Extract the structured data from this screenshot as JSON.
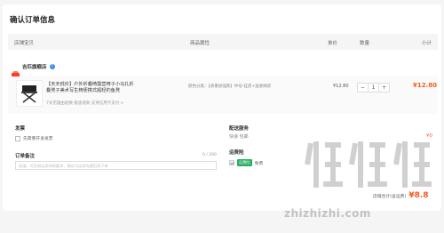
{
  "title": "确认订单信息",
  "table_header": {
    "shop": "店铺宝贝",
    "attr": "商品属性",
    "price": "单价",
    "qty": "数量",
    "subtotal": "小计"
  },
  "shop": {
    "name": "吉匹旗舰店",
    "info_icon": "?"
  },
  "item": {
    "title": "【天天低价】户外折叠椅露营椅子小马扎折叠凳子美术写生椅便携式超轻钓鱼凳",
    "tags": "7天无理由退换  极速退款  支持信用卡支付 >",
    "attr": "颜色分类：【承重加强款】中号-挂黑+送收纳袋",
    "unit_price": "¥12.80",
    "qty_minus": "−",
    "qty_value": "1",
    "qty_plus": "+",
    "subtotal": "¥12.80"
  },
  "invoice": {
    "label": "发票",
    "option": "先需要开发发票"
  },
  "remark": {
    "label": "订单备注",
    "counter": "0 / 200",
    "placeholder": "选填，可告知店家你的要求，建议与店家沟通后再下单"
  },
  "delivery": {
    "label": "配送服务",
    "method": "快递 包邮",
    "fee": "¥0"
  },
  "insurance": {
    "label": "运费险",
    "badge": "运费险",
    "value": "免费"
  },
  "total": {
    "label": "店铺合计(含运费)",
    "amount": "¥8.8"
  },
  "watermark": {
    "url": "zhizhizhi.com"
  },
  "colors": {
    "accent": "#f55a1e",
    "info": "#3a8ee6",
    "green": "#27ae60"
  }
}
